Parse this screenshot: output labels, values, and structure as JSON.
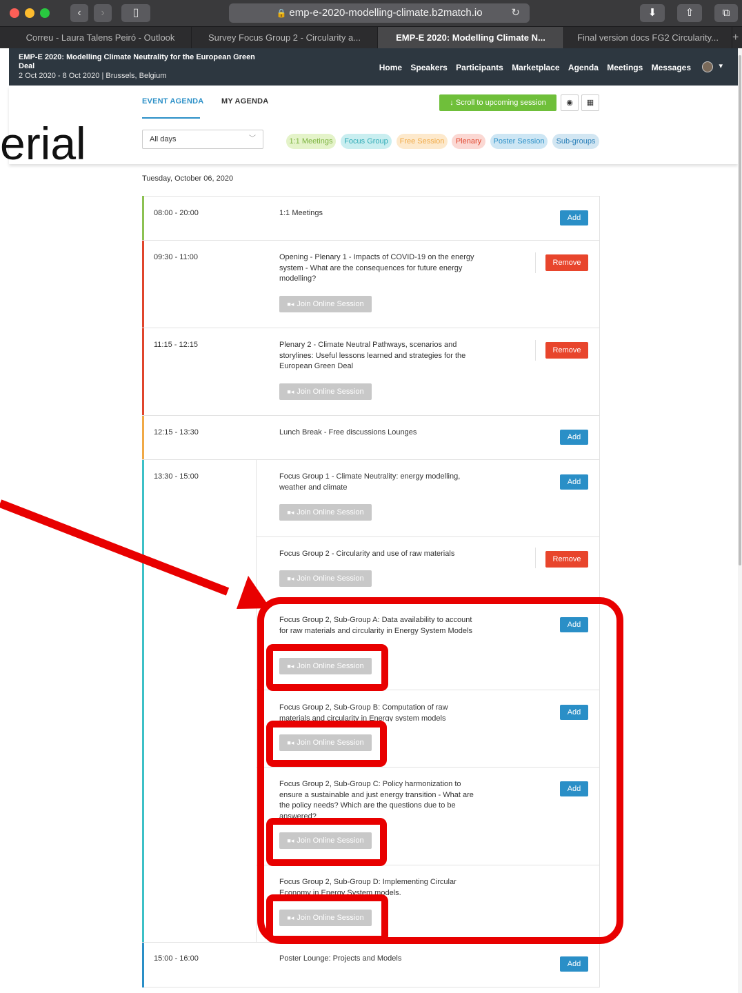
{
  "browser": {
    "url": "emp-e-2020-modelling-climate.b2match.io",
    "tabs": [
      {
        "label": "Correu - Laura Talens Peiró - Outlook"
      },
      {
        "label": "Survey Focus Group 2 - Circularity a..."
      },
      {
        "label": "EMP-E 2020: Modelling Climate N..."
      },
      {
        "label": "Final version docs FG2 Circularity..."
      }
    ],
    "new_tab": "+"
  },
  "site": {
    "title": "EMP-E 2020: Modelling Climate Neutrality for the European Green Deal",
    "subtitle": "2 Oct 2020 - 8 Oct 2020 | Brussels, Belgium",
    "nav": [
      "Home",
      "Speakers",
      "Participants",
      "Marketplace",
      "Agenda",
      "Meetings",
      "Messages"
    ]
  },
  "overlay_text": "erial",
  "agenda": {
    "tabs": [
      "EVENT AGENDA",
      "MY AGENDA"
    ],
    "scroll_label": "Scroll to upcoming session",
    "day_filter": "All days",
    "chips": [
      {
        "label": "1:1 Meetings",
        "bg": "#e4f3c9",
        "fg": "#7cb33f"
      },
      {
        "label": "Focus Group",
        "bg": "#c9eef0",
        "fg": "#2aa8b4"
      },
      {
        "label": "Free Session",
        "bg": "#fde9cc",
        "fg": "#f0a946"
      },
      {
        "label": "Plenary",
        "bg": "#fbd8d3",
        "fg": "#e0452c"
      },
      {
        "label": "Poster Session",
        "bg": "#cde6f4",
        "fg": "#2a8fc7"
      },
      {
        "label": "Sub-groups",
        "bg": "#d2e6f2",
        "fg": "#2a7fb8"
      }
    ],
    "date": "Tuesday, October 06, 2020",
    "join_label": "Join Online Session",
    "add_label": "Add",
    "remove_label": "Remove",
    "sessions": [
      {
        "time": "08:00 - 20:00",
        "title": "1:1 Meetings"
      },
      {
        "time": "09:30 - 11:00",
        "title": "Opening - Plenary 1 - Impacts of COVID-19 on the energy system - What are the consequences for future energy modelling?"
      },
      {
        "time": "11:15 - 12:15",
        "title": "Plenary 2 - Climate Neutral Pathways, scenarios and storylines: Useful lessons learned and strategies for the European Green Deal"
      },
      {
        "time": "12:15 - 13:30",
        "title": "Lunch Break - Free discussions Lounges"
      },
      {
        "time": "13:30 - 15:00",
        "title": "Focus Group 1 - Climate Neutrality: energy modelling, weather and climate"
      },
      {
        "time": "",
        "title": "Focus Group 2 - Circularity and use of raw materials"
      },
      {
        "time": "",
        "title": "Focus Group 2, Sub-Group A: Data availability to account for raw materials and circularity in Energy System Models"
      },
      {
        "time": "",
        "title": "Focus Group 2, Sub-Group B: Computation of raw materials and circularity in Energy system models"
      },
      {
        "time": "",
        "title": "Focus Group 2, Sub-Group C: Policy harmonization to ensure a sustainable and just energy transition - What are the policy needs? Which are the questions due to be answered?"
      },
      {
        "time": "",
        "title": "Focus Group 2, Sub-Group D: Implementing Circular Economy in Energy System models."
      },
      {
        "time": "15:00 - 16:00",
        "title": "Poster Lounge: Projects and Models"
      }
    ]
  }
}
